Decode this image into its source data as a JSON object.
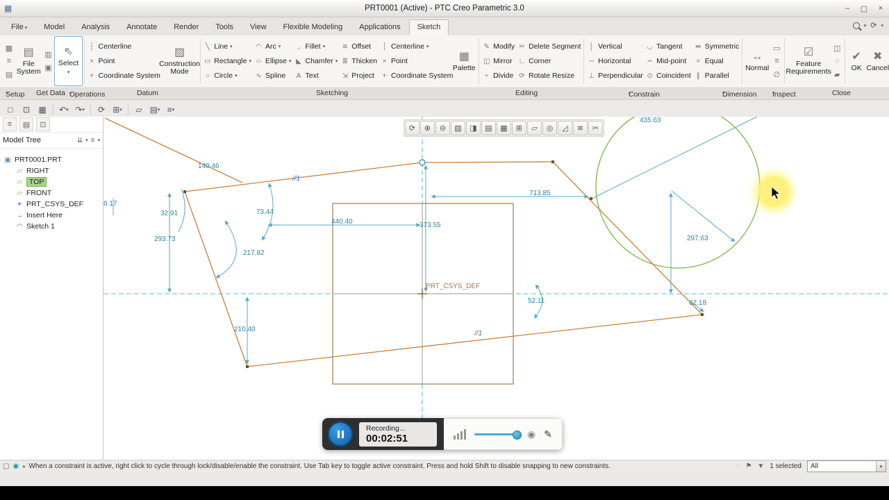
{
  "title_bar": {
    "title": "PRT0001 (Active) - PTC Creo Parametric 3.0"
  },
  "tabs": {
    "file": "File",
    "model": "Model",
    "analysis": "Analysis",
    "annotate": "Annotate",
    "render": "Render",
    "tools": "Tools",
    "view": "View",
    "flexible_modeling": "Flexible Modeling",
    "applications": "Applications",
    "sketch": "Sketch"
  },
  "ribbon": {
    "setup": {
      "file_system": "File System",
      "select": "Select"
    },
    "datum": {
      "centerline": "Centerline",
      "point": "Point",
      "csys": "Coordinate System",
      "construction": "Construction Mode"
    },
    "sketching": {
      "line": "Line",
      "rectangle": "Rectangle",
      "circle": "Circle",
      "arc": "Arc",
      "ellipse": "Ellipse",
      "spline": "Spline",
      "fillet": "Fillet",
      "chamfer": "Chamfer",
      "text": "Text",
      "offset": "Offset",
      "thicken": "Thicken",
      "project": "Project",
      "centerline": "Centerline",
      "point": "Point",
      "csys": "Coordinate System",
      "palette": "Palette"
    },
    "editing": {
      "modify": "Modify",
      "mirror": "Mirror",
      "divide": "Divide",
      "delete_segment": "Delete Segment",
      "corner": "Corner",
      "rotate_resize": "Rotate Resize"
    },
    "constrain": {
      "vertical": "Vertical",
      "horizontal": "Horizontal",
      "perpendicular": "Perpendicular",
      "tangent": "Tangent",
      "midpoint": "Mid-point",
      "coincident": "Coincident",
      "symmetric": "Symmetric",
      "equal": "Equal",
      "parallel": "Parallel"
    },
    "dimension": {
      "normal": "Normal"
    },
    "inspect": {
      "feature_req": "Feature Requirements"
    },
    "close": {
      "ok": "OK",
      "cancel": "Cancel"
    }
  },
  "group_labels": {
    "setup": "Setup",
    "get_data": "Get Data",
    "operations": "Operations",
    "datum": "Datum",
    "sketching": "Sketching",
    "editing": "Editing",
    "constrain": "Constrain",
    "dimension": "Dimension",
    "inspect": "Inspect",
    "close": "Close"
  },
  "model_tree": {
    "title": "Model Tree",
    "items": {
      "part": "PRT0001.PRT",
      "right": "RIGHT",
      "top": "TOP",
      "front": "FRONT",
      "csys": "PRT_CSYS_DEF",
      "insert": "Insert Here",
      "sketch": "Sketch 1"
    }
  },
  "canvas": {
    "csys_label": "PRT_CSYS_DEF",
    "dims": {
      "d435": "435.63",
      "d140": "140.46",
      "d6": "6.17",
      "d32": "32.91",
      "d293": "293.73",
      "d73": "73.44",
      "d217": "217.82",
      "d440": "440.40",
      "d373": "373.55",
      "d713": "713.85",
      "d297": "297.63",
      "d52": "52.11",
      "d62": "62.18",
      "d210": "210.40"
    },
    "constraints": {
      "p1": "//1",
      "p2": "//1"
    }
  },
  "recorder": {
    "status": "Recording...",
    "time": "00:02:51"
  },
  "status_bar": {
    "message": "When a constraint is active, right click to cycle through lock/disable/enable the constraint. Use Tab key to toggle active constraint. Press and hold Shift to disable snapping to new constraints.",
    "selected_count": "1 selected",
    "filter_value": "All"
  },
  "colors": {
    "sketch_line": "#c9803d",
    "dimension": "#2b85a8",
    "reference": "#9b7d52",
    "circle_green": "#7cb342",
    "centerline": "#49c3d6",
    "highlight": "#fff176",
    "selection_green": "#a6d58b",
    "ok_green": "#1e8e3e"
  },
  "icons": {
    "caret": "▾",
    "app": "▦",
    "minimize": "–",
    "maximize": "▢",
    "close": "×",
    "refresh": "⟳",
    "setup_a": "▩",
    "setup_b": "≡",
    "setup_c": "▤",
    "file_system": "▤",
    "select": "⇖",
    "copy": "▥",
    "paste": "▣",
    "centerline": "┆",
    "point": "×",
    "csys": "+",
    "construction": "▨",
    "line": "╲",
    "rectangle": "▭",
    "circle": "○",
    "arc": "◠",
    "ellipse": "○",
    "spline": "∿",
    "fillet": "◞",
    "chamfer": "◣",
    "text": "A",
    "offset": "≋",
    "thicken": "≣",
    "project": "⇲",
    "palette": "▦",
    "modify": "✎",
    "mirror": "◫",
    "divide": "÷",
    "delete_segment": "✂",
    "corner": "∟",
    "rotate_resize": "⟳",
    "vertical": "│",
    "horizontal": "─",
    "perpendicular": "⊥",
    "tangent": "◡",
    "midpoint": "∸",
    "coincident": "⊙",
    "symmetric": "⇹",
    "equal": "=",
    "parallel": "∥",
    "normal": "↔",
    "dim_b": "▭",
    "dim_c": "≡",
    "dim_d": "∅",
    "feature_req": "☑",
    "insp_b": "◫",
    "insp_c": "◌",
    "insp_d": "▰",
    "ok": "✔",
    "cancel": "✖",
    "new": "□",
    "open": "⊡",
    "save": "▦",
    "undo": "↶",
    "redo": "↷",
    "regen": "⟳",
    "display": "⊞",
    "planes": "▱",
    "grid": "▤",
    "list": "≡",
    "tree_a": "≡",
    "tree_b": "▤",
    "tree_c": "⊡",
    "filter": "⇊",
    "part": "▣",
    "plane": "▱",
    "csys_tree": "+",
    "insert": "→",
    "sketch": "◠",
    "refit": "⟳",
    "zoom_in": "⊕",
    "zoom_out": "⊖",
    "repaint": "▧",
    "style": "◨",
    "views": "▤",
    "vmgr": "▦",
    "datum_disp": "⊞",
    "annot": "▱",
    "spin": "◎",
    "sk_view": "◿",
    "sk_disp": "≋",
    "cutter": "✂",
    "record": "◉",
    "pencil": "✎",
    "doc": "▢",
    "globe": "◉",
    "bullet": "•",
    "dots": "⋯",
    "flag": "⚑",
    "funnel": "▼"
  }
}
